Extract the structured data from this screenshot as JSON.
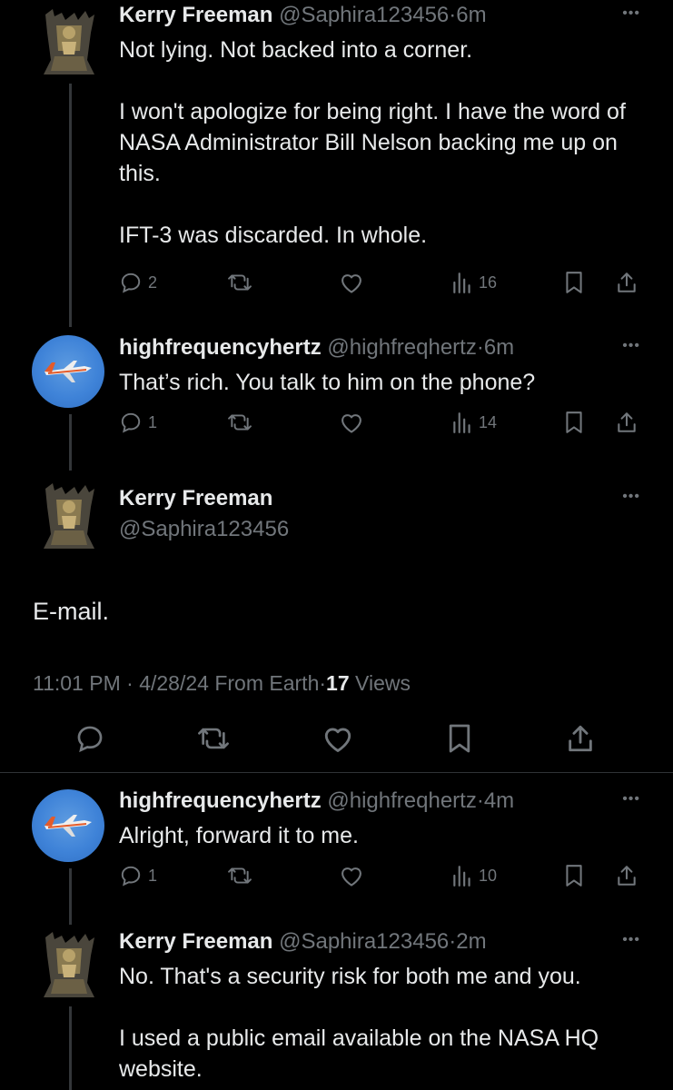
{
  "tweets": [
    {
      "name": "Kerry Freeman",
      "handle": "@Saphira123456",
      "time": "6m",
      "text": "Not lying. Not backed into a corner.\n\nI won't apologize for being right. I have the word of NASA Administrator Bill Nelson backing me up on this.\n\nIFT-3 was discarded. In whole.",
      "replies": "2",
      "views": "16"
    },
    {
      "name": "highfrequencyhertz",
      "handle": "@highfreqhertz",
      "time": "6m",
      "text": "That’s rich. You talk to him on the phone?",
      "replies": "1",
      "views": "14"
    }
  ],
  "focused": {
    "name": "Kerry Freeman",
    "handle": "@Saphira123456",
    "text": "E-mail.",
    "time": "11:01 PM",
    "date": "4/28/24",
    "source": "From Earth",
    "views_count": "17",
    "views_label": "Views"
  },
  "replies": [
    {
      "name": "highfrequencyhertz",
      "handle": "@highfreqhertz",
      "time": "4m",
      "text": "Alright, forward it to me.",
      "replies": "1",
      "views": "10"
    },
    {
      "name": "Kerry Freeman",
      "handle": "@Saphira123456",
      "time": "2m",
      "text": "No. That's a security risk for both me and you.\n\nI used a public email available on the NASA HQ website."
    }
  ],
  "colors": {
    "background": "#000000",
    "text": "#e7e9ea",
    "muted": "#71767b",
    "thread_line": "#333639"
  },
  "icons": [
    "reply-icon",
    "retweet-icon",
    "like-icon",
    "views-icon",
    "bookmark-icon",
    "share-icon",
    "more-icon"
  ]
}
